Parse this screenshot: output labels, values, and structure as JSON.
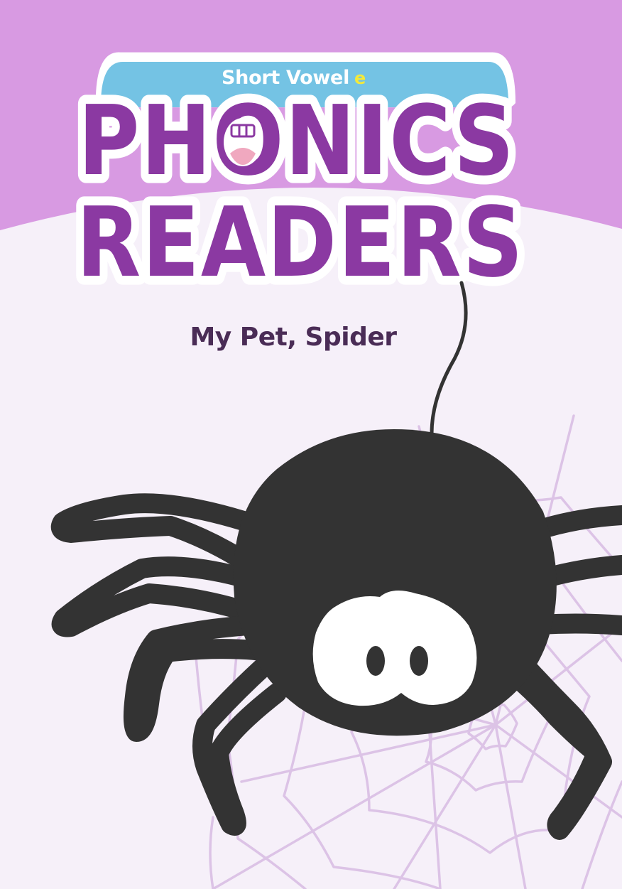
{
  "cover": {
    "series_label": "Short Vowel",
    "series_vowel": "e",
    "title_line_1": "PHONICS",
    "title_line_2": "READERS",
    "book_title": "My Pet, Spider"
  },
  "colors": {
    "top_band": "#d89ae2",
    "page_background": "#f6f0f9",
    "logo_purple": "#8b39a2",
    "banner_blue": "#74c3e4",
    "title_text": "#4a2c56",
    "spider": "#333333",
    "web_lines": "#dcc3e6"
  },
  "icons": {
    "mouth": "phonics-mouth-icon",
    "spider": "spider-illustration",
    "web": "spider-web-illustration"
  }
}
